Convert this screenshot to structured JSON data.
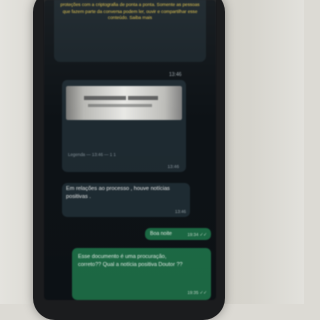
{
  "chat": {
    "notice_text": "proteções com a criptografia de ponta a ponta. Somente as pessoas que fazem parte da conversa podem ler, ouvir e compartilhar esse conteúdo. Saiba mais",
    "notice_time": "13:46",
    "image_message": {
      "caption": "Legenda — 13:46 — 1 1",
      "time": "13:46"
    },
    "incoming_message": {
      "text": "Em relações ao processo , houve notícias positivas .",
      "time": "13:46"
    },
    "outgoing_messages": [
      {
        "text": "Boa noite",
        "time": "19:34 ✓✓"
      },
      {
        "text": "Esse documento é uma procuração, correto?? Qual a notícia positiva Doutor ??",
        "time": "19:35 ✓✓"
      }
    ]
  },
  "colors": {
    "chat_background": "#0d1216",
    "incoming_bubble": "#1f2c33",
    "outgoing_bubble": "#1d6c46",
    "notice_text": "#e3c44a"
  }
}
